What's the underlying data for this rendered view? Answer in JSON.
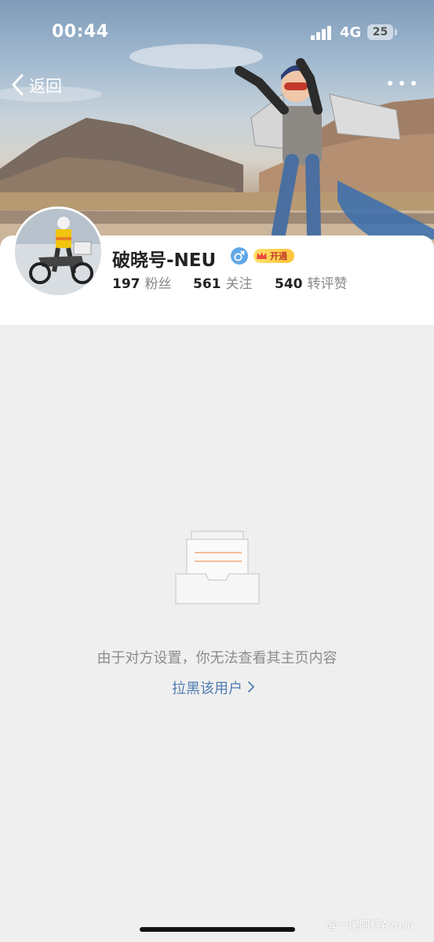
{
  "status_bar": {
    "time": "00:44",
    "network": "4G",
    "battery": "25"
  },
  "nav": {
    "back_label": "返回",
    "more_icon": "more-dots-icon"
  },
  "profile": {
    "username": "破晓号-NEU",
    "gender_icon": "male-icon",
    "vip_label": "开通",
    "stats": [
      {
        "value": "197",
        "label": "粉丝"
      },
      {
        "value": "561",
        "label": "关注"
      },
      {
        "value": "540",
        "label": "转评赞"
      }
    ]
  },
  "empty_state": {
    "icon": "empty-inbox-icon",
    "message": "由于对方设置，你无法查看其主页内容",
    "block_link": "拉黑该用户"
  },
  "watermark": "@一尾阿梓Azusa",
  "colors": {
    "link": "#4f7bb0",
    "gender": "#5fa8e8",
    "vip": "#ffc43a",
    "background": "#efefef"
  }
}
